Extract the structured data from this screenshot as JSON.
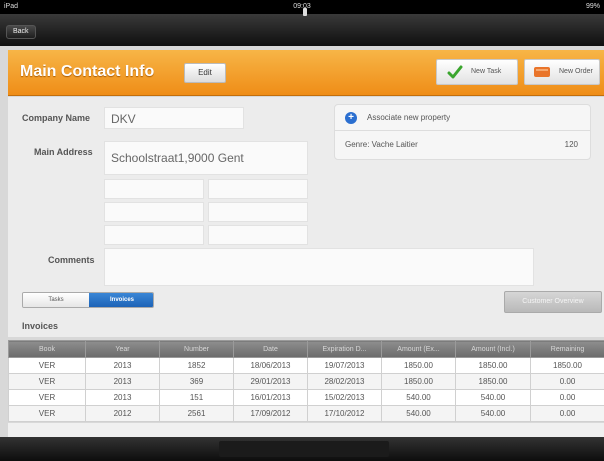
{
  "status_bar": {
    "carrier": "iPad",
    "time": "09:03",
    "battery": "99%"
  },
  "nav": {
    "back_label": "Back"
  },
  "header": {
    "title": "Main Contact Info",
    "edit_label": "Edit",
    "new_task_label": "New Task",
    "new_order_label": "New Order",
    "accent": "#ef8d17"
  },
  "form": {
    "company_name_label": "Company Name",
    "company_name_value": "DKV",
    "main_address_label": "Main Address",
    "main_address_value": "Schoolstraat1,9000 Gent",
    "comments_label": "Comments",
    "comments_value": ""
  },
  "property_panel": {
    "associate_label": "Associate new property",
    "genre_label": "Genre: Vache Laitier",
    "genre_count": "120"
  },
  "segment": {
    "tasks_label": "Tasks",
    "invoices_label": "Invoices",
    "selected": "Invoices"
  },
  "customer_overview_label": "Customer Overview",
  "invoices": {
    "heading": "Invoices",
    "columns": [
      "Book",
      "Year",
      "Number",
      "Date",
      "Expiration D...",
      "Amount (Ex...",
      "Amount (Incl.)",
      "Remaining"
    ],
    "rows": [
      [
        "VER",
        "2013",
        "1852",
        "18/06/2013",
        "19/07/2013",
        "1850.00",
        "1850.00",
        "1850.00"
      ],
      [
        "VER",
        "2013",
        "369",
        "29/01/2013",
        "28/02/2013",
        "1850.00",
        "1850.00",
        "0.00"
      ],
      [
        "VER",
        "2013",
        "151",
        "16/01/2013",
        "15/02/2013",
        "540.00",
        "540.00",
        "0.00"
      ],
      [
        "VER",
        "2012",
        "2561",
        "17/09/2012",
        "17/10/2012",
        "540.00",
        "540.00",
        "0.00"
      ]
    ]
  }
}
